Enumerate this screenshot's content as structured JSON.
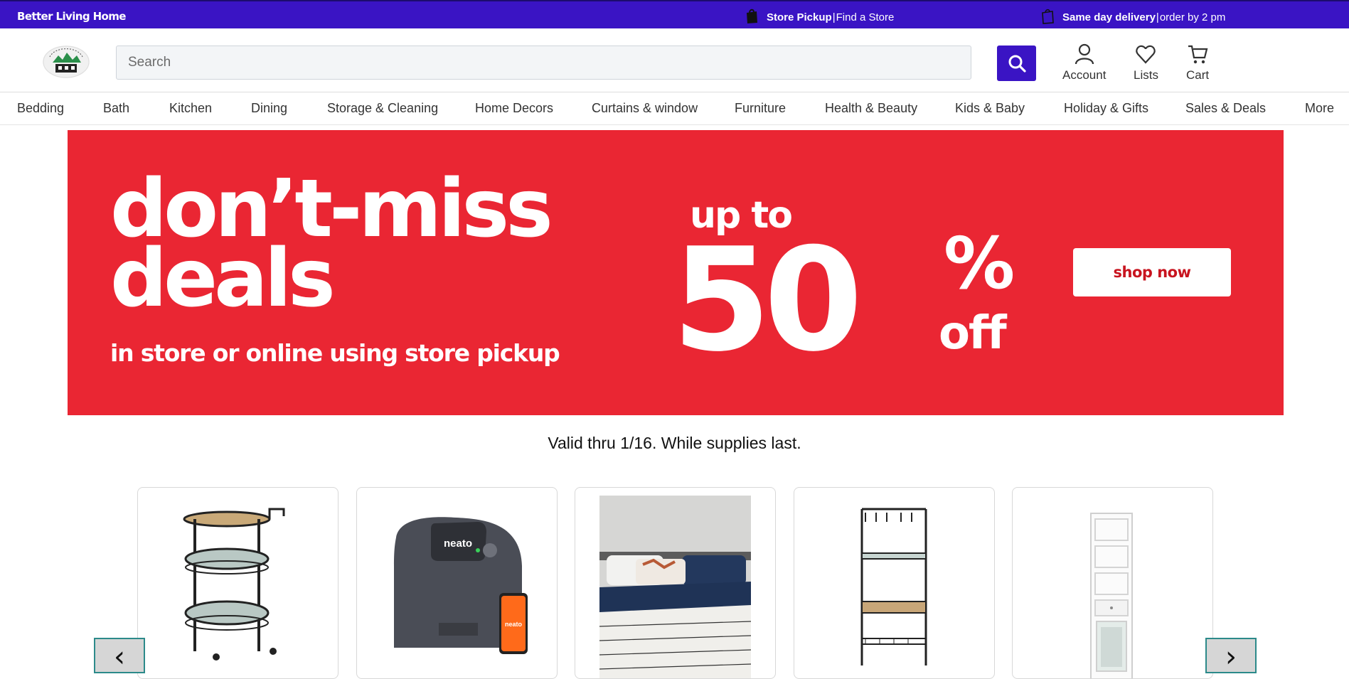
{
  "topbar": {
    "brand": "Better Living Home",
    "pickup_bold": "Store Pickup",
    "pickup_sep": "|",
    "pickup_link": "Find a Store",
    "delivery_bold": "Same day delivery",
    "delivery_sep": "|",
    "delivery_text": "order by 2 pm",
    "icons": [
      "shopping-bag-icon",
      "shopping-bag-outline-icon"
    ]
  },
  "header": {
    "search_placeholder": "Search",
    "account_label": "Account",
    "lists_label": "Lists",
    "cart_label": "Cart",
    "accent_color": "#3a14c4"
  },
  "nav": {
    "items": [
      "Bedding",
      "Bath",
      "Kitchen",
      "Dining",
      "Storage & Cleaning",
      "Home Decors",
      "Curtains & window",
      "Furniture",
      "Health & Beauty",
      "Kids & Baby",
      "Holiday & Gifts",
      "Sales & Deals",
      "More"
    ]
  },
  "hero": {
    "line1": "don’t-miss",
    "line2": "deals",
    "subline": "in store or online using store pickup",
    "upto": "up to",
    "percent": "50",
    "percent_sign": "%",
    "off": "off",
    "cta": "shop now",
    "background_color": "#ea2633"
  },
  "valid_text": "Valid thru 1/16. While supplies last.",
  "products": {
    "items": [
      {
        "name": "bar-cart-product"
      },
      {
        "name": "robot-vacuum-product",
        "brand_text": "neato"
      },
      {
        "name": "bedding-set-product"
      },
      {
        "name": "storage-shelf-product"
      },
      {
        "name": "linen-cabinet-product"
      }
    ],
    "prev_arrow": "‹",
    "next_arrow": "›"
  }
}
